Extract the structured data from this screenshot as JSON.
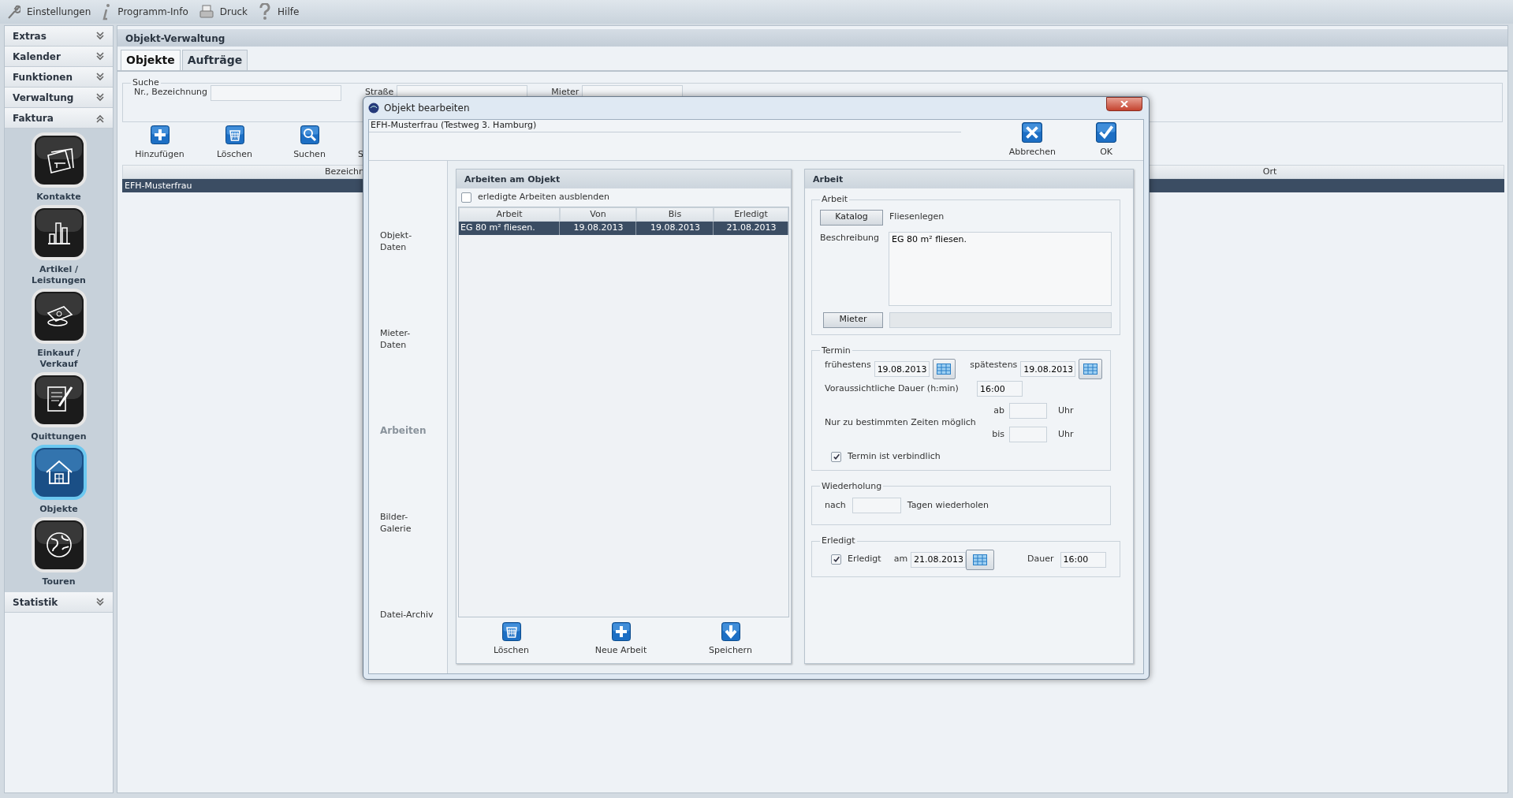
{
  "menu_bar": [
    {
      "label": "Einstellungen"
    },
    {
      "label": "Programm-Info"
    },
    {
      "label": "Druck"
    },
    {
      "label": "Hilfe"
    }
  ],
  "sidebar": {
    "sections": [
      {
        "label": "Extras",
        "expanded": false
      },
      {
        "label": "Kalender",
        "expanded": false
      },
      {
        "label": "Funktionen",
        "expanded": false
      },
      {
        "label": "Verwaltung",
        "expanded": false
      },
      {
        "label": "Faktura",
        "expanded": true,
        "items": [
          {
            "lines": [
              "Kontakte"
            ],
            "selected": false
          },
          {
            "lines": [
              "Artikel /",
              "Leistungen"
            ],
            "selected": false
          },
          {
            "lines": [
              "Einkauf /",
              "Verkauf"
            ],
            "selected": false
          },
          {
            "lines": [
              "Quittungen"
            ],
            "selected": false
          },
          {
            "lines": [
              "Objekte"
            ],
            "selected": true
          },
          {
            "lines": [
              "Touren"
            ],
            "selected": false
          }
        ]
      },
      {
        "label": "Statistik",
        "expanded": false
      }
    ]
  },
  "main": {
    "title": "Objekt-Verwaltung",
    "tabs": [
      {
        "label": "Objekte",
        "selected": true
      },
      {
        "label": "Aufträge",
        "selected": false
      }
    ],
    "search": {
      "title": "Suche",
      "fields": [
        {
          "label": "Nr., Bezeichnung"
        },
        {
          "label": "Straße"
        },
        {
          "label": "Mieter"
        }
      ]
    },
    "toolbar": [
      {
        "label": "Hinzufügen"
      },
      {
        "label": "Löschen"
      },
      {
        "label": "Suchen"
      },
      {
        "label": "S"
      }
    ],
    "table": {
      "columns": [
        "Bezeichn",
        "Ort"
      ],
      "rows": [
        {
          "cells": [
            "EFH-Musterfrau"
          ],
          "selected": true
        }
      ]
    }
  },
  "dialog": {
    "title": "Objekt bearbeiten",
    "subtitle": "EFH-Musterfrau (Testweg 3. Hamburg)",
    "actions": [
      {
        "label": "Abbrechen"
      },
      {
        "label": "OK"
      }
    ],
    "nav": [
      {
        "lines": [
          "Objekt-",
          "Daten"
        ],
        "selected": false
      },
      {
        "lines": [
          "Mieter-",
          "Daten"
        ],
        "selected": false
      },
      {
        "lines": [
          "Arbeiten"
        ],
        "selected": true
      },
      {
        "lines": [
          "Bilder-",
          "Galerie"
        ],
        "selected": false
      },
      {
        "lines": [
          "Datei-Archiv"
        ],
        "selected": false
      }
    ],
    "work_list": {
      "title": "Arbeiten am Objekt",
      "hide_done": {
        "label": "erledigte Arbeiten ausblenden",
        "checked": false
      },
      "columns": [
        "Arbeit",
        "Von",
        "Bis",
        "Erledigt"
      ],
      "rows": [
        {
          "cells": [
            "EG 80 m² fliesen.",
            "19.08.2013",
            "19.08.2013",
            "21.08.2013"
          ],
          "selected": true
        }
      ],
      "buttons": [
        {
          "label": "Löschen"
        },
        {
          "label": "Neue Arbeit"
        },
        {
          "label": "Speichern"
        }
      ]
    },
    "work": {
      "title": "Arbeit",
      "arbeit": {
        "legend": "Arbeit",
        "catalog_button": "Katalog",
        "catalog_value": "Fliesenlegen",
        "description_label": "Beschreibung",
        "description": "EG 80 m² fliesen.",
        "tenant_button": "Mieter"
      },
      "termin": {
        "legend": "Termin",
        "earliest_label": "frühestens",
        "earliest": "19.08.2013",
        "latest_label": "spätestens",
        "latest": "19.08.2013",
        "duration_label": "Voraussichtliche Dauer (h:min)",
        "duration": "16:00",
        "times_label": "Nur zu bestimmten Zeiten möglich",
        "from_label": "ab",
        "to_label": "bis",
        "unit_from": "Uhr",
        "unit_to": "Uhr",
        "binding": {
          "label": "Termin ist verbindlich",
          "checked": true
        }
      },
      "repeat": {
        "legend": "Wiederholung",
        "prefix": "nach",
        "suffix": "Tagen wiederholen"
      },
      "done": {
        "legend": "Erledigt",
        "check": {
          "label": "Erledigt",
          "checked": true
        },
        "date_label": "am",
        "date": "21.08.2013",
        "duration_label": "Dauer",
        "duration": "16:00"
      }
    }
  }
}
